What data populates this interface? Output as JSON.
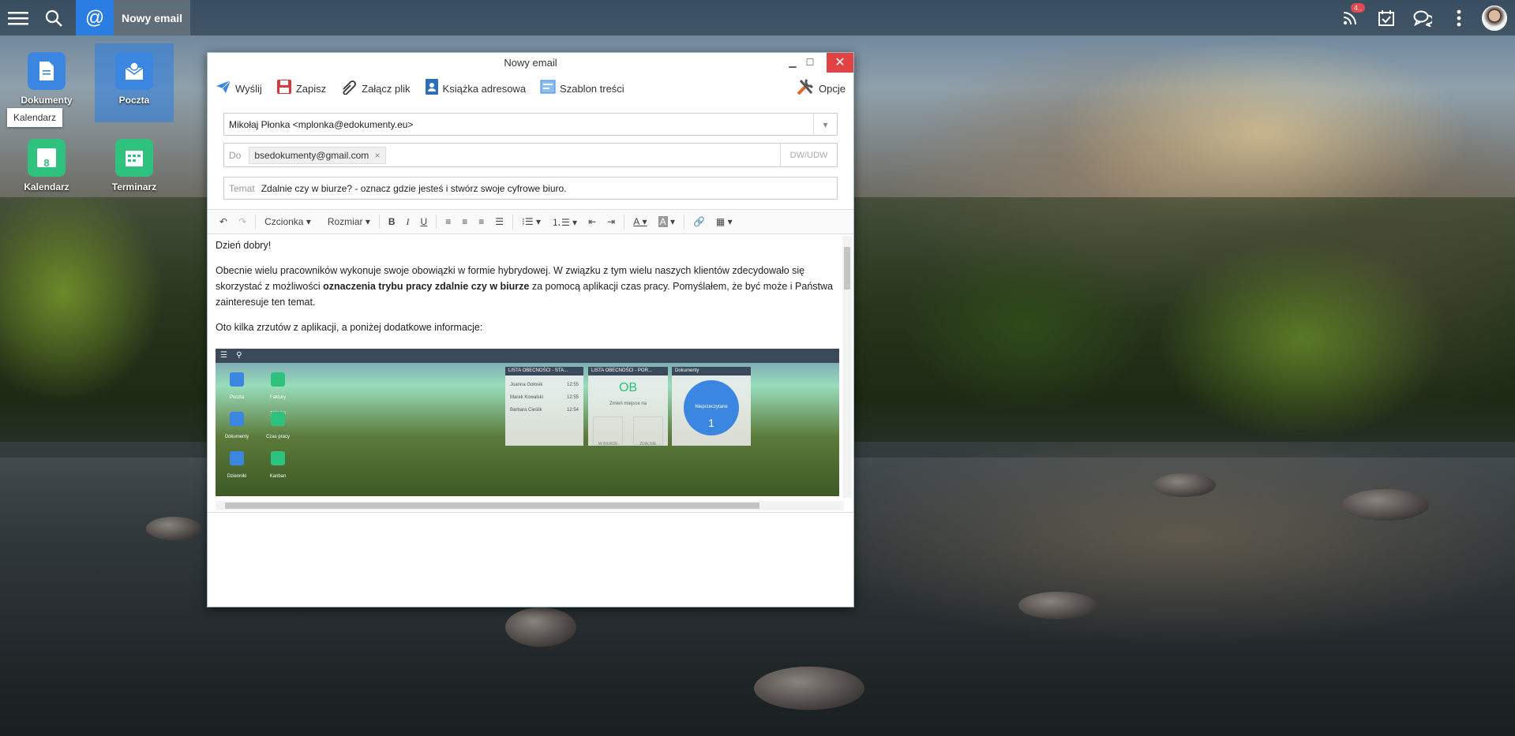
{
  "topbar": {
    "active_title": "Nowy email",
    "badge_count": "4.."
  },
  "desktop": {
    "icons": [
      {
        "label": "Dokumenty"
      },
      {
        "label": "Poczta"
      },
      {
        "label": "Kalendarz",
        "day": "8"
      },
      {
        "label": "Terminarz"
      }
    ],
    "tooltip": "Kalendarz"
  },
  "window": {
    "title": "Nowy email",
    "toolbar": {
      "send": "Wyślij",
      "save": "Zapisz",
      "attach": "Załącz plik",
      "address_book": "Książka adresowa",
      "template": "Szablon treści",
      "options": "Opcje"
    },
    "from": "Mikołaj Płonka <mplonka@edokumenty.eu>",
    "to_label": "Do",
    "to_recipient": "bsedokumenty@gmail.com",
    "cc_bcc": "DW/UDW",
    "subject_label": "Temat",
    "subject": "Zdalnie czy w biurze? - oznacz gdzie jesteś i stwórz swoje cyfrowe biuro.",
    "editor": {
      "font": "Czcionka",
      "size": "Rozmiar"
    },
    "body": {
      "greeting": "Dzień dobry!",
      "para1_a": "Obecnie wielu pracowników wykonuje swoje obowiązki w formie hybrydowej. W związku z tym wielu naszych klientów zdecydowało się skorzystać z możliwości ",
      "para1_bold": "oznaczenia trybu pracy zdalnie czy w biurze",
      "para1_b": " za pomocą aplikacji czas pracy. Pomyślałem, że być może i Państwa zainteresuje ten temat.",
      "para2": "Oto kilka zrzutów z aplikacji, a poniżej dodatkowe informacje:",
      "screenshot": {
        "panel1": "LISTA OBECNOŚCI - STA...",
        "panel2": "LISTA OBECNOŚCI - POR...",
        "panel3": "Dokumenty",
        "status": "OB",
        "status_sub": "Zmień miejsce na",
        "office": "W BIURZE",
        "remote": "ZDALNIE",
        "unread_label": "Nieprzeczytane",
        "unread_count": "1",
        "people": [
          {
            "name": "Joanna Gołosik",
            "time": "12:55"
          },
          {
            "name": "Marek Kowalski",
            "time": "12:55"
          },
          {
            "name": "Barbara Cieślik",
            "time": "12:54"
          }
        ],
        "apps": [
          "Poczta",
          "Faktury zakupu",
          "Dokumenty",
          "Czas pracy",
          "Dzienniki",
          "Kanban"
        ]
      }
    }
  }
}
